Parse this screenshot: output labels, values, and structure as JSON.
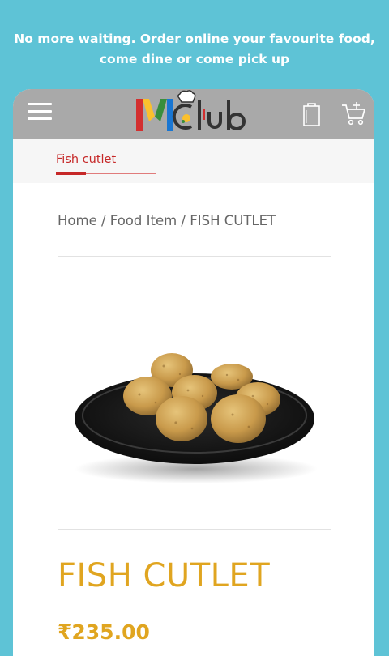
{
  "promo": {
    "line1": "No more waiting. Order online your favourite food,",
    "line2": "come dine or come pick up"
  },
  "header": {
    "logo_text": "MClub",
    "menu_icon": "hamburger-icon",
    "wishlist_icon": "bag-icon",
    "cart_icon": "cart-icon",
    "bar_color": "#a9a9a9"
  },
  "tabs": {
    "active_label": "Fish cutlet"
  },
  "breadcrumb": {
    "home": "Home",
    "separator": " / ",
    "category": "Food Item",
    "current": "FISH CUTLET"
  },
  "product": {
    "title": "FISH CUTLET",
    "price": "₹235.00",
    "accent_color": "#e0a520"
  }
}
